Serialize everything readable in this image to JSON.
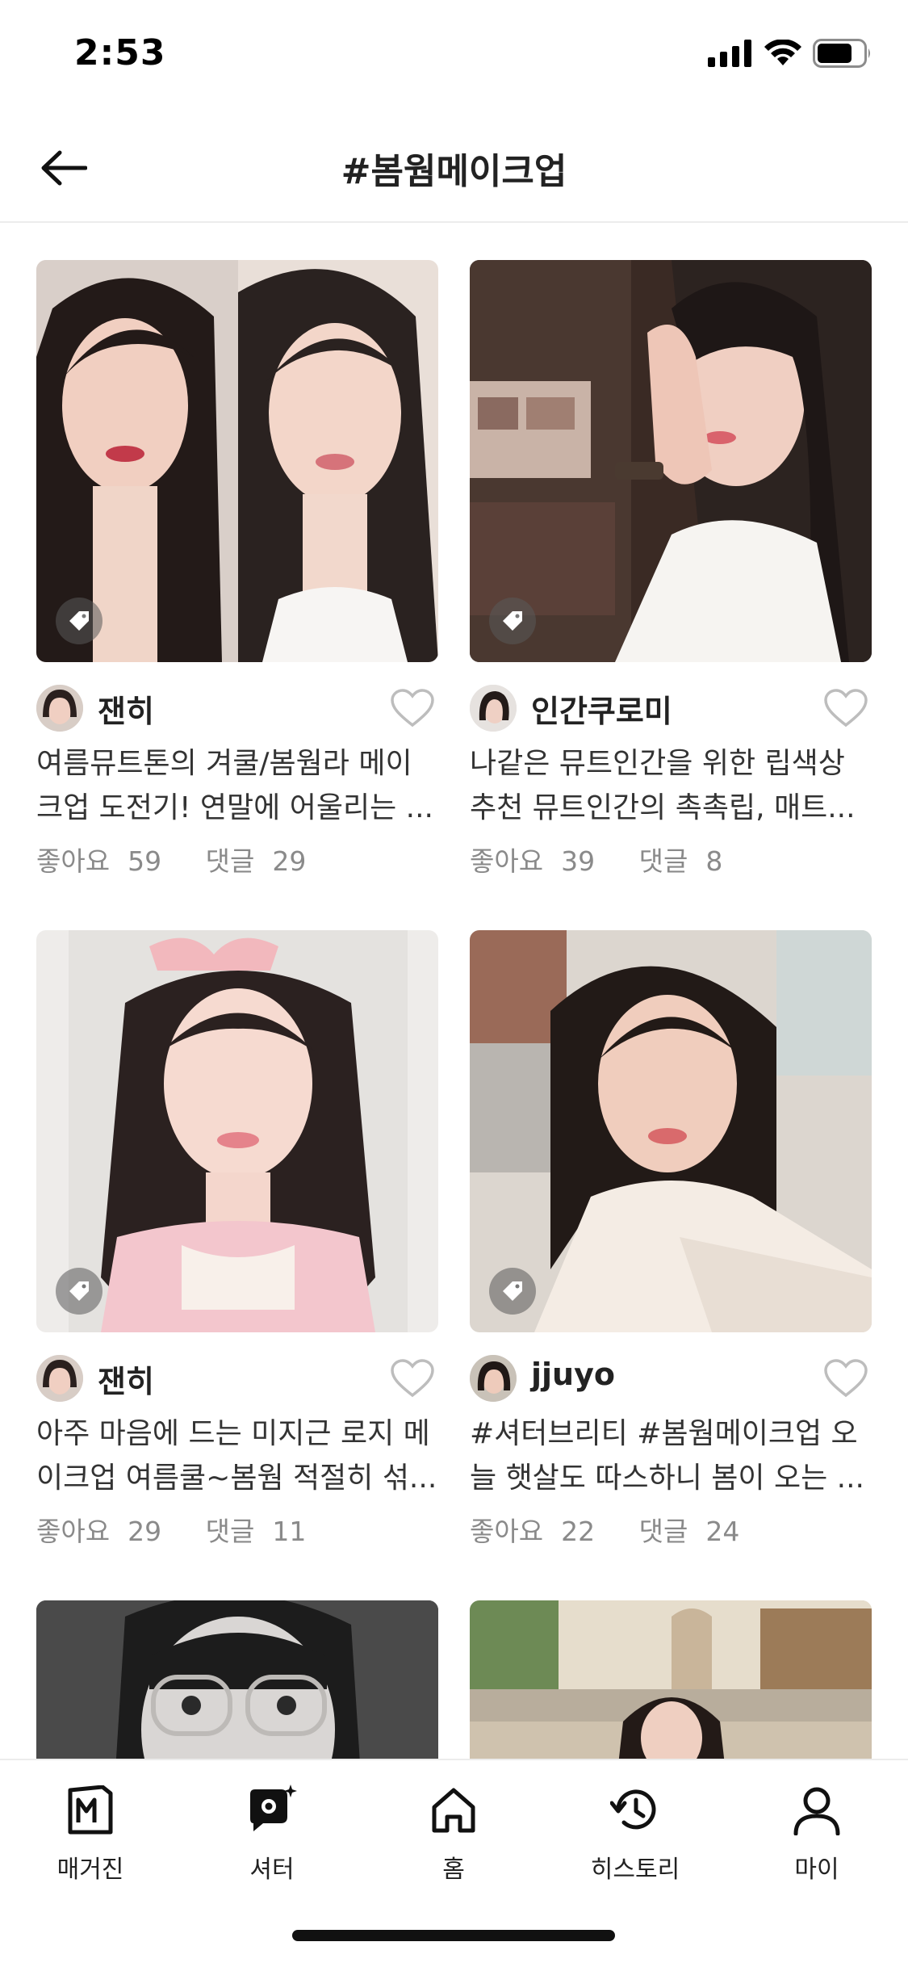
{
  "status": {
    "time": "2:53"
  },
  "header": {
    "title": "#봄웜메이크업"
  },
  "posts": [
    {
      "author": "잰히",
      "desc": "여름뮤트톤의 겨쿨/봄웜라 메이크업 도전기! 연말에 어울리는 ...",
      "likes_label": "좋아요",
      "likes": "59",
      "comments_label": "댓글",
      "comments": "29"
    },
    {
      "author": "인간쿠로미",
      "desc": "나같은 뮤트인간을 위한 립색상 추천 뮤트인간의 촉촉립, 매트...",
      "likes_label": "좋아요",
      "likes": "39",
      "comments_label": "댓글",
      "comments": "8"
    },
    {
      "author": "잰히",
      "desc": "아주 마음에 드는 미지근 로지 메이크업 여름쿨~봄웜 적절히 섞...",
      "likes_label": "좋아요",
      "likes": "29",
      "comments_label": "댓글",
      "comments": "11"
    },
    {
      "author": "jjuyo",
      "desc": "#셔터브리티 #봄웜메이크업 오늘 햇살도 따스하니 봄이 오는 ...",
      "likes_label": "좋아요",
      "likes": "22",
      "comments_label": "댓글",
      "comments": "24"
    }
  ],
  "nav": {
    "magazine": "매거진",
    "shutter": "셔터",
    "home": "홈",
    "history": "히스토리",
    "my": "마이"
  },
  "icons": [
    "back-arrow-icon",
    "tag-icon",
    "heart-icon",
    "magazine-icon",
    "shutter-icon",
    "home-icon",
    "history-icon",
    "profile-icon"
  ]
}
